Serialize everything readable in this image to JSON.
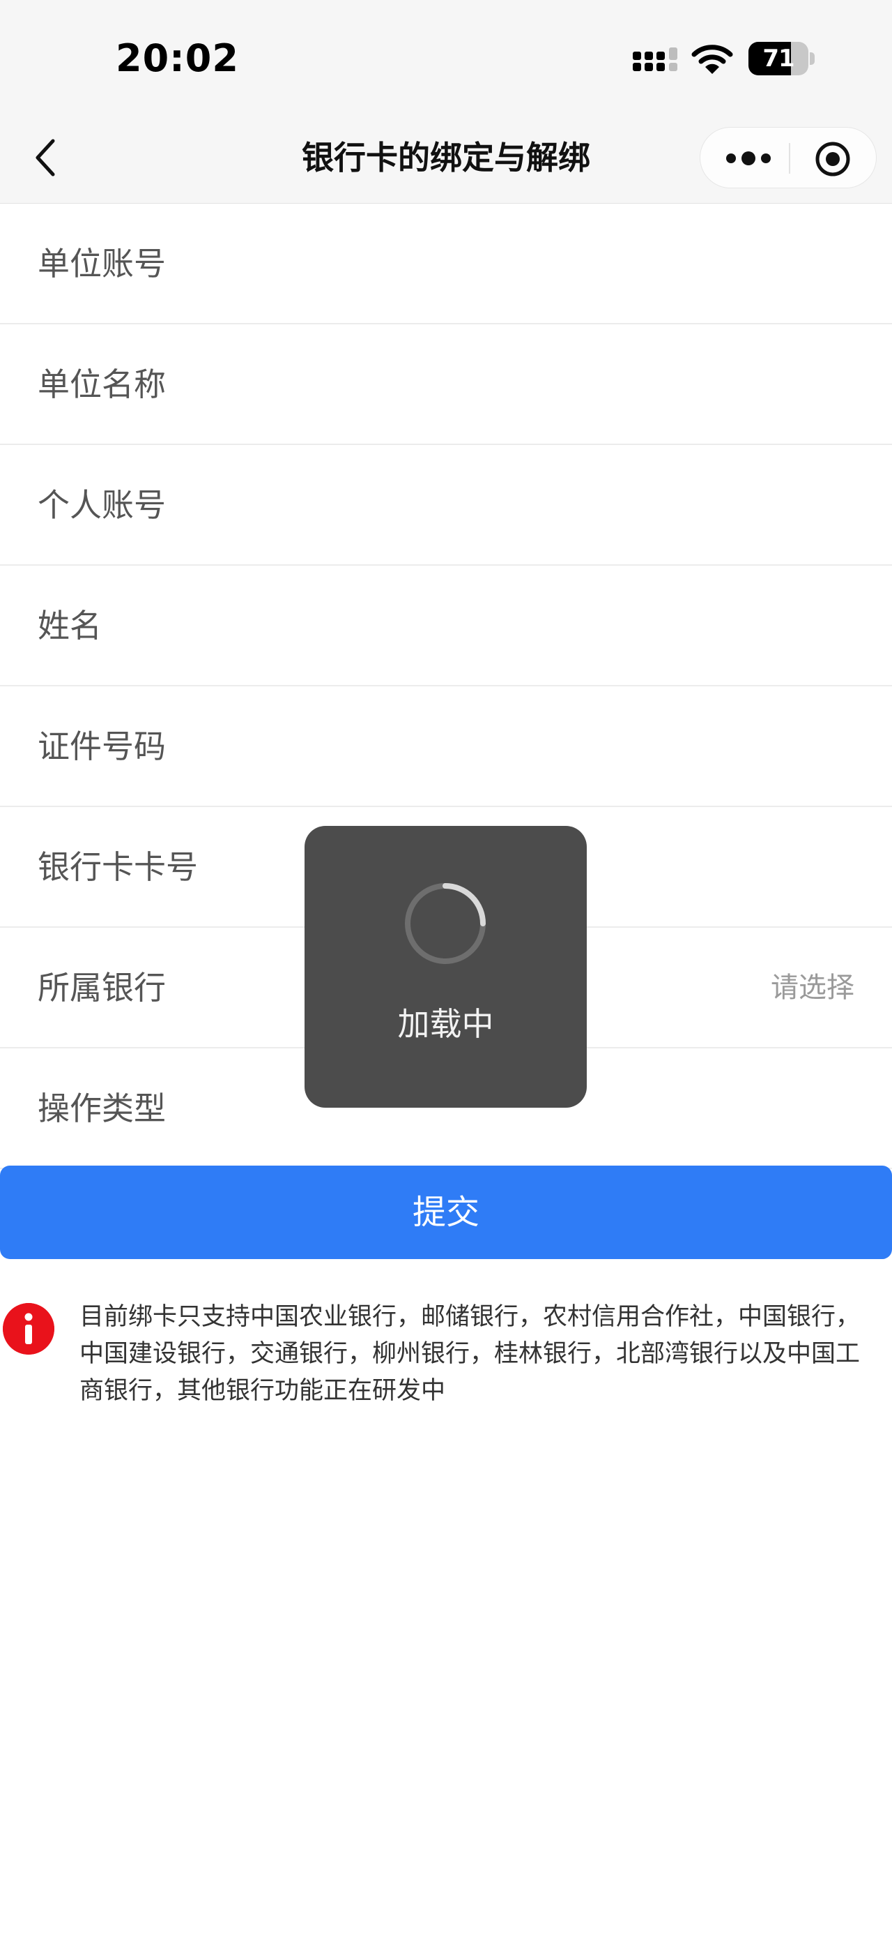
{
  "status_bar": {
    "time": "20:02",
    "battery_level": "71",
    "battery_fraction": 0.71,
    "icons": [
      "signal-icon",
      "wifi-icon",
      "battery-icon"
    ]
  },
  "nav": {
    "title": "银行卡的绑定与解绑",
    "back_icon": "back-chevron-icon",
    "more_icon": "more-dots-icon",
    "close_icon": "miniprogram-close-icon"
  },
  "form": {
    "fields": [
      {
        "label": "单位账号"
      },
      {
        "label": "单位名称"
      },
      {
        "label": "个人账号"
      },
      {
        "label": "姓名"
      },
      {
        "label": "证件号码"
      },
      {
        "label": "银行卡卡号"
      },
      {
        "label": "所属银行",
        "select_hint": "请选择"
      },
      {
        "label": "操作类型"
      }
    ]
  },
  "submit": {
    "label": "提交",
    "color": "#2f7cf6"
  },
  "notice": {
    "icon": "info-alert-icon",
    "icon_color": "#e9121b",
    "text": "目前绑卡只支持中国农业银行，邮储银行，农村信用合作社，中国银行，中国建设银行，交通银行，柳州银行，桂林银行，北部湾银行以及中国工商银行，其他银行功能正在研发中"
  },
  "toast": {
    "text": "加载中",
    "icon": "loading-spinner-icon"
  }
}
